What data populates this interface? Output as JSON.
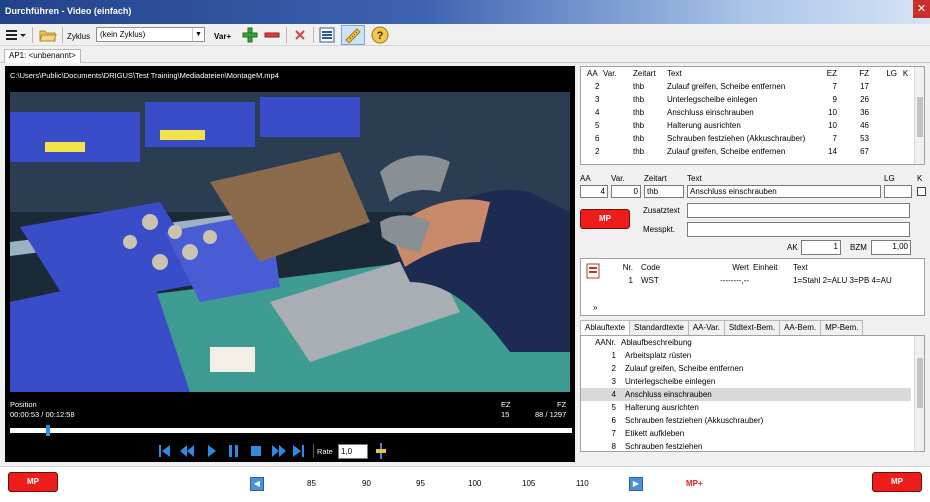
{
  "window": {
    "title": "Durchführen - Video (einfach)",
    "close": "✕"
  },
  "toolbar": {
    "cycle_label": "Zyklus",
    "cycle_value": "(kein Zyklus)",
    "var_label": "Var+"
  },
  "doc_tab": "AP1: <unbenannt>",
  "video": {
    "path": "C:\\Users\\Public\\Documents\\DRIGUS\\Test Training\\Mediadateien\\MontageM.mp4",
    "position_label": "Position",
    "position_value": "00:00:53 / 00:12:58",
    "ez_label": "EZ",
    "ez_value": "15",
    "fz_label": "FZ",
    "fz_value": "88 / 1297",
    "progress_fraction": 0.068,
    "rate_label": "Rate",
    "rate_value": "1,0"
  },
  "steps_table": {
    "headers": [
      "AA",
      "Var.",
      "Zeitart",
      "Text",
      "EZ",
      "FZ",
      "LG",
      "K"
    ],
    "rows": [
      {
        "aa": "2",
        "var": "",
        "zeitart": "thb",
        "text": "Zulauf greifen, Scheibe entfernen",
        "ez": "7",
        "fz": "17"
      },
      {
        "aa": "3",
        "var": "",
        "zeitart": "thb",
        "text": "Unterlegscheibe einlegen",
        "ez": "9",
        "fz": "26"
      },
      {
        "aa": "4",
        "var": "",
        "zeitart": "thb",
        "text": "Anschluss einschrauben",
        "ez": "10",
        "fz": "36"
      },
      {
        "aa": "5",
        "var": "",
        "zeitart": "thb",
        "text": "Halterung ausrichten",
        "ez": "10",
        "fz": "46"
      },
      {
        "aa": "6",
        "var": "",
        "zeitart": "thb",
        "text": "Schrauben festziehen (Akkuschrauber)",
        "ez": "7",
        "fz": "53"
      },
      {
        "aa": "2",
        "var": "",
        "zeitart": "thb",
        "text": "Zulauf greifen, Scheibe entfernen",
        "ez": "14",
        "fz": "67"
      }
    ]
  },
  "editor": {
    "aa_label": "AA",
    "var_label": "Var.",
    "zeitart_label": "Zeitart",
    "text_label": "Text",
    "lg_label": "LG",
    "k_label": "K",
    "aa_value": "4",
    "var_value": "0",
    "zeitart_value": "thb",
    "text_value": "Anschluss einschrauben",
    "mp_button": "MP",
    "zusatztext_label": "Zusatztext",
    "messpkt_label": "Messpkt.",
    "ak_label": "AK",
    "ak_value": "1",
    "bzm_label": "BZM",
    "bzm_value": "1,00"
  },
  "influence_table": {
    "headers": [
      "Nr.",
      "Code",
      "Wert",
      "Einheit",
      "Text"
    ],
    "row": {
      "nr": "1",
      "code": "WST",
      "wert": "--------,--",
      "einheit": "",
      "text": "1=Stahl 2=ALU 3=PB 4=AU"
    }
  },
  "bottom_tabs": [
    "Ablauftexte",
    "Standardtexte",
    "AA-Var.",
    "Stdtext-Bem.",
    "AA-Bem.",
    "MP-Bem."
  ],
  "sequence_table": {
    "headers": [
      "AANr.",
      "Ablaufbeschreibung"
    ],
    "rows": [
      {
        "nr": "1",
        "text": "Arbeitsplatz rüsten"
      },
      {
        "nr": "2",
        "text": "Zulauf greifen, Scheibe entfernen"
      },
      {
        "nr": "3",
        "text": "Unterlegscheibe einlegen"
      },
      {
        "nr": "4",
        "text": "Anschluss einschrauben"
      },
      {
        "nr": "5",
        "text": "Halterung ausrichten"
      },
      {
        "nr": "6",
        "text": "Schrauben festziehen (Akkuschrauber)"
      },
      {
        "nr": "7",
        "text": "Etikett aufkleben"
      },
      {
        "nr": "8",
        "text": "Schrauben festziehen"
      }
    ]
  },
  "footer": {
    "mp_left": "MP",
    "mp_right": "MP",
    "mp_plus": "MP+",
    "ticks": [
      "85",
      "90",
      "95",
      "100",
      "105",
      "110"
    ]
  }
}
